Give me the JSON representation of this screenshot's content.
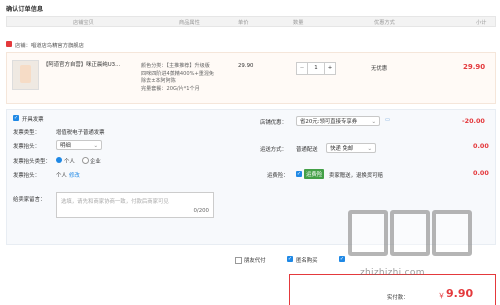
{
  "page_title": "确认订单信息",
  "columns": [
    "店铺宝贝",
    "商品属性",
    "单价",
    "数量",
    "优惠方式",
    "小计"
  ],
  "store": {
    "label": "店铺：",
    "name": "唱道店鸟精官方旗舰店"
  },
  "item": {
    "title": "【阿道官方自营】咪正晨纯U3...",
    "spec_lines": [
      "颜色分类：【主推推荐】升级版",
      "四咪四阶进4蒸精400%+重混免",
      "除去±本阿阿陈",
      "完量套餐：20G/片*1个月"
    ],
    "unit_price": "29.90",
    "quantity": "1",
    "minus": "−",
    "plus": "+",
    "discount": "无优惠",
    "subtotal": "29.90"
  },
  "invoice": {
    "checkbox_label": "开具发票",
    "type_label": "发票类型：",
    "type_value": "增值税电子普通发票",
    "content_label": "发票抬头：",
    "content_value": "明细",
    "title_type_label": "发票抬头类型：",
    "radio_personal": "个人",
    "radio_company": "企业",
    "header_label": "发票抬头：",
    "header_value": "个人",
    "header_edit": "修改"
  },
  "note": {
    "label": "给卖家留言：",
    "placeholder": "选填，请先和商家协商一致，付款后商家可见",
    "counter": "0/200"
  },
  "shop_discount": {
    "label": "店铺优惠：",
    "value": "省20元:领可直接专享券",
    "amount": "-20.00"
  },
  "shipping": {
    "label": "运送方式：",
    "value": "普通配送",
    "carrier": "快递 免邮",
    "amount": "0.00"
  },
  "insurance": {
    "label": "运费险：",
    "badge": "运费险",
    "text": "卖家赠送，退换货可赔",
    "amount": "0.00"
  },
  "footer": {
    "anon": "匿名购买",
    "realname": "匿名购买",
    "pay_other": "朋友代付"
  },
  "total": {
    "label": "实付款：",
    "currency": "￥",
    "amount": "9.90"
  },
  "watermark": {
    "text": "zhizhizhi.com"
  },
  "colors": {
    "accent": "#e4393c",
    "link": "#1e88e5"
  }
}
